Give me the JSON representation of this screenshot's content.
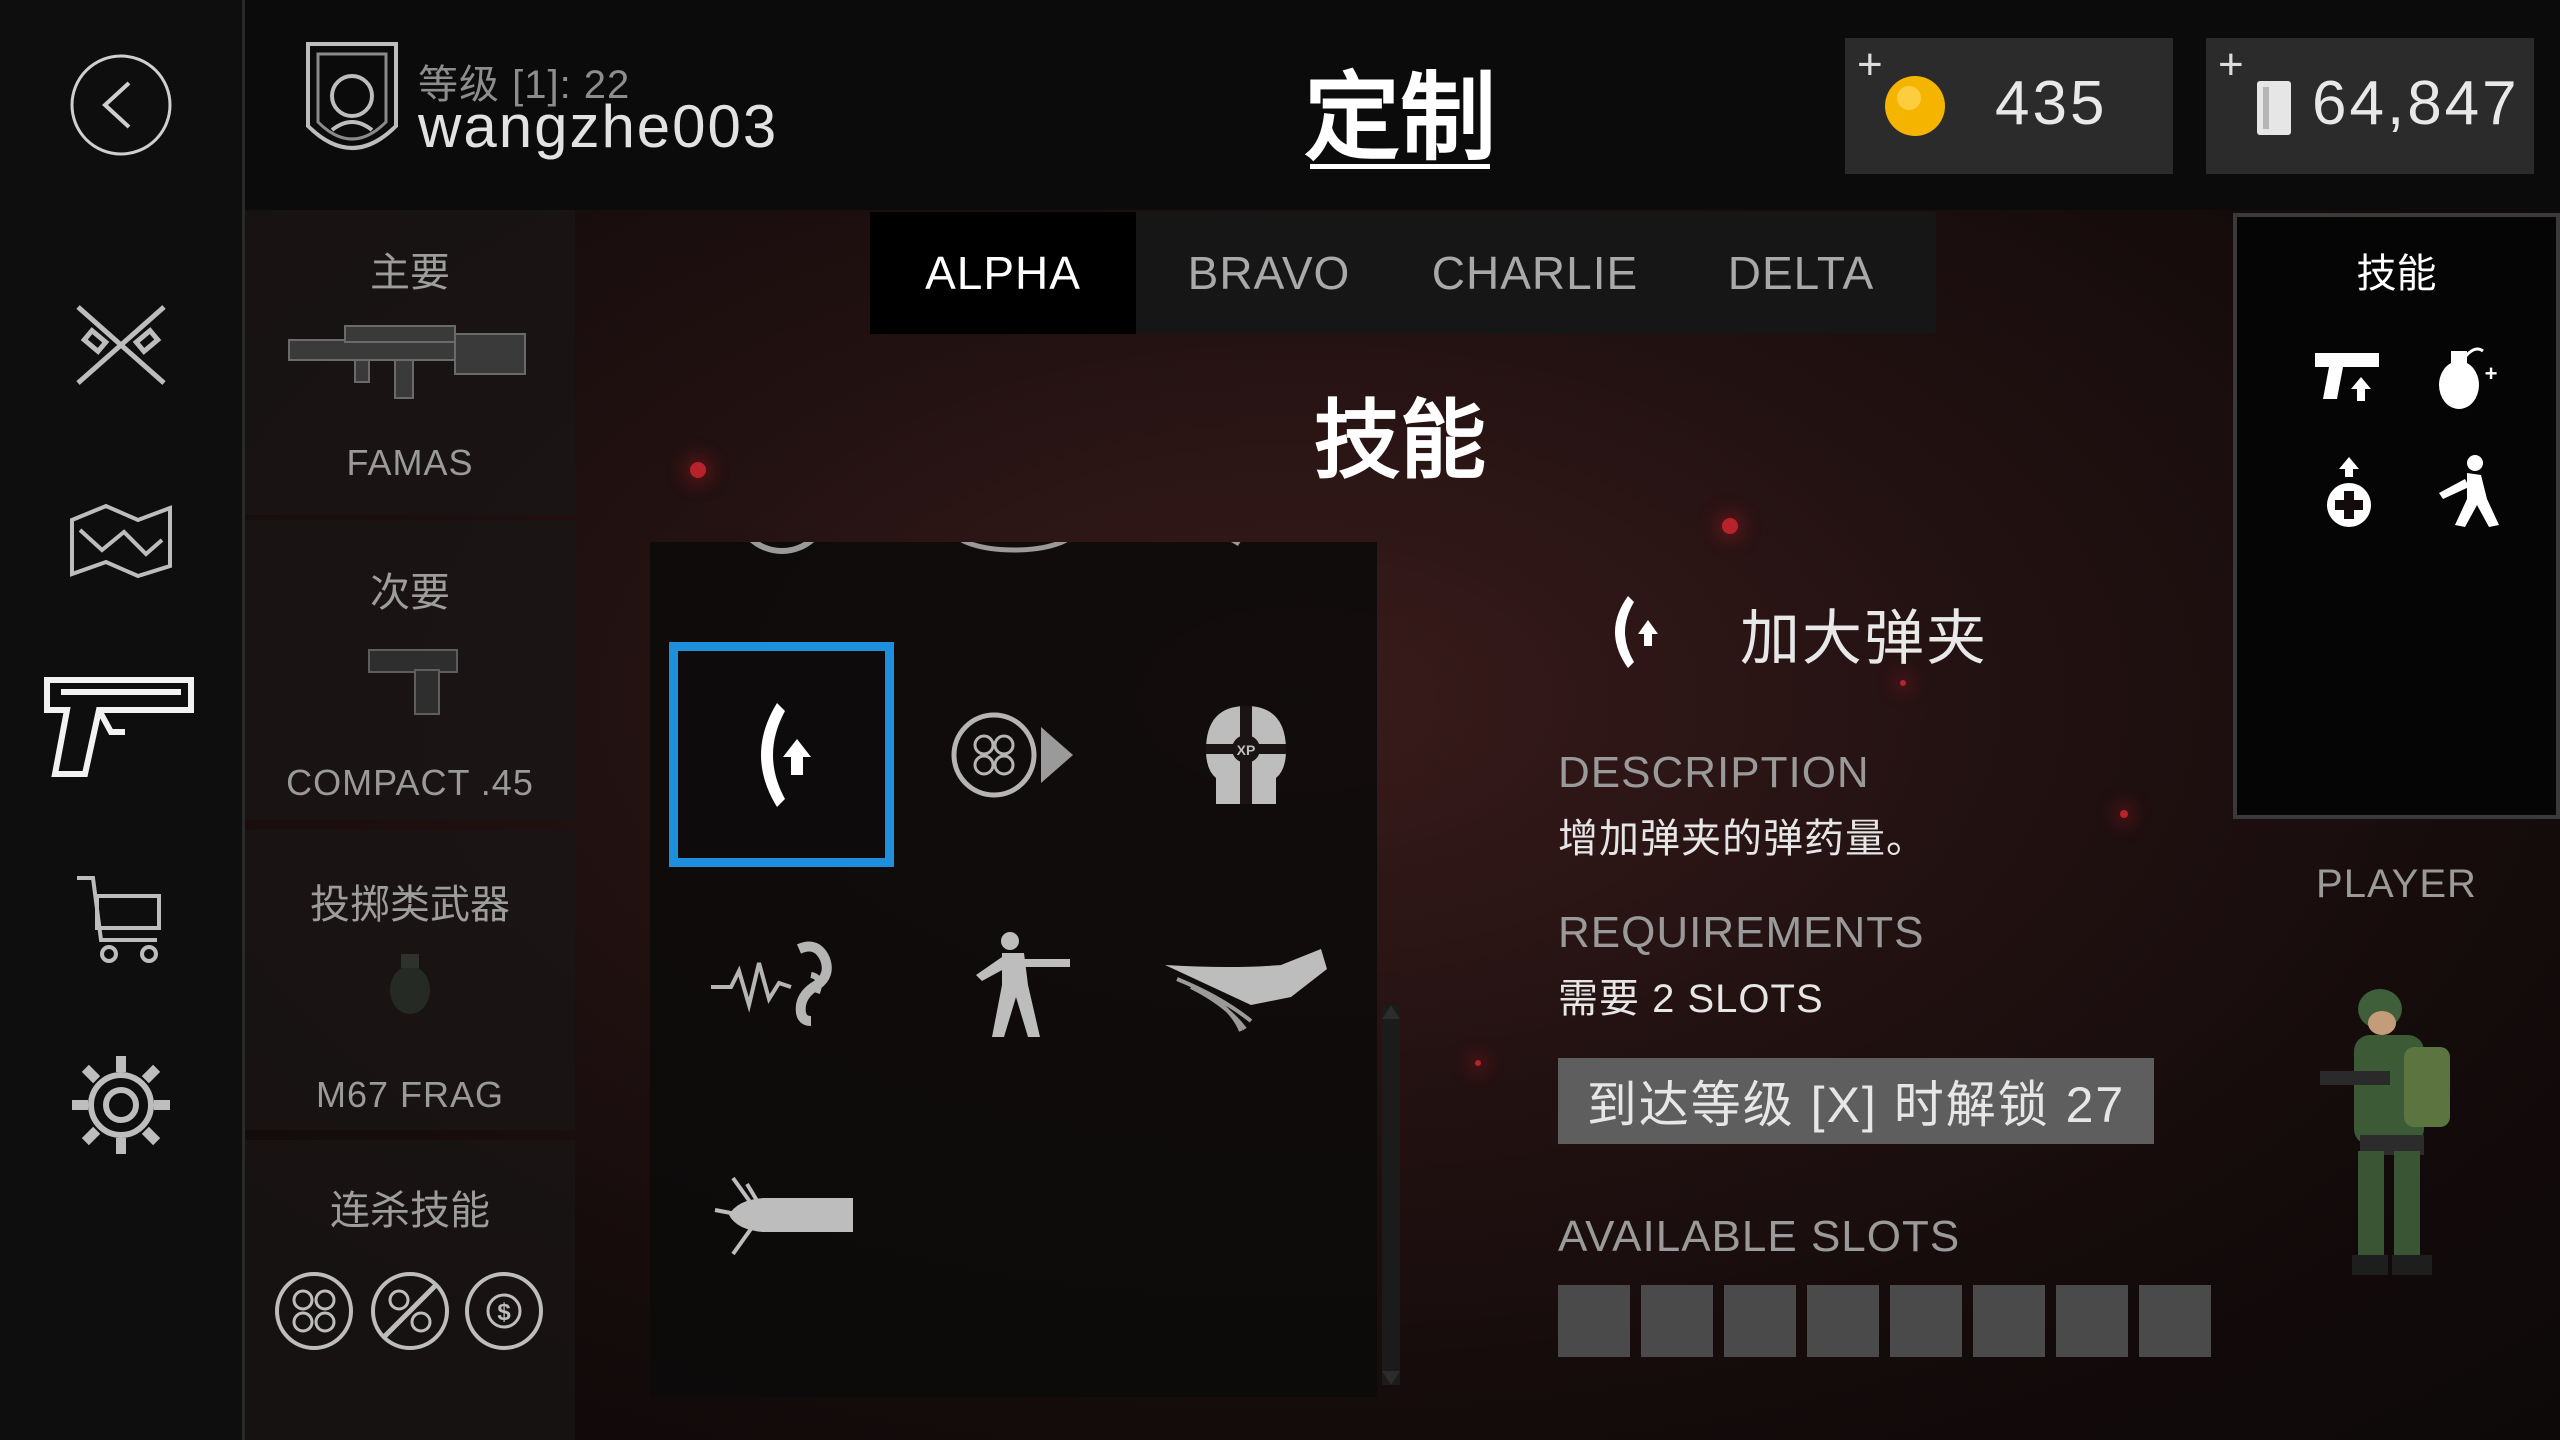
{
  "header": {
    "rank_label": "等级 [1]: 22",
    "username": "wangzhe003",
    "title": "定制",
    "coins": {
      "plus": "+",
      "value": "435"
    },
    "cash": {
      "plus": "+",
      "value": "64,847"
    }
  },
  "nav": {
    "items": [
      "back-icon",
      "crossed-weapons-icon",
      "map-icon",
      "pistol-icon",
      "cart-icon",
      "gear-icon"
    ],
    "active": "pistol-icon"
  },
  "loadout": {
    "primary": {
      "category": "主要",
      "weapon": "FAMAS"
    },
    "secondary": {
      "category": "次要",
      "weapon": "COMPACT .45"
    },
    "throwable": {
      "category": "投掷类武器",
      "weapon": "M67 FRAG"
    },
    "killstreak": {
      "category": "连杀技能",
      "icons": [
        "drone-icon",
        "drone-disabled-icon",
        "cash-drone-icon"
      ]
    }
  },
  "tabs": [
    "ALPHA",
    "BRAVO",
    "CHARLIE",
    "DELTA"
  ],
  "active_tab": "ALPHA",
  "section_title": "技能",
  "skills_grid": {
    "selected": "extended-mag-icon",
    "icons": [
      "speed-icon",
      "stealth-icon",
      "hand-icon",
      "extended-mag-icon",
      "drone-boost-icon",
      "xp-head-icon",
      "hearing-icon",
      "soldier-icon",
      "fast-hand-icon",
      "bullet-icon"
    ]
  },
  "detail": {
    "name": "加大弹夹",
    "description_label": "DESCRIPTION",
    "description": "增加弹夹的弹药量。",
    "requirements_label": "REQUIREMENTS",
    "requirements": "需要 2 SLOTS",
    "unlock_label": "到达等级 [X] 时解锁 27",
    "available_slots_label": "AVAILABLE SLOTS",
    "available_slots_count": 8
  },
  "equipped_panel": {
    "title": "技能",
    "icons": [
      "gun-skill-icon",
      "grenade-plus-icon",
      "medkit-icon",
      "sprint-icon"
    ]
  },
  "player": {
    "label": "PLAYER"
  },
  "colors": {
    "selection": "#1e8fdc",
    "coin": "#f5b400",
    "accent_red": "#b8232b"
  }
}
